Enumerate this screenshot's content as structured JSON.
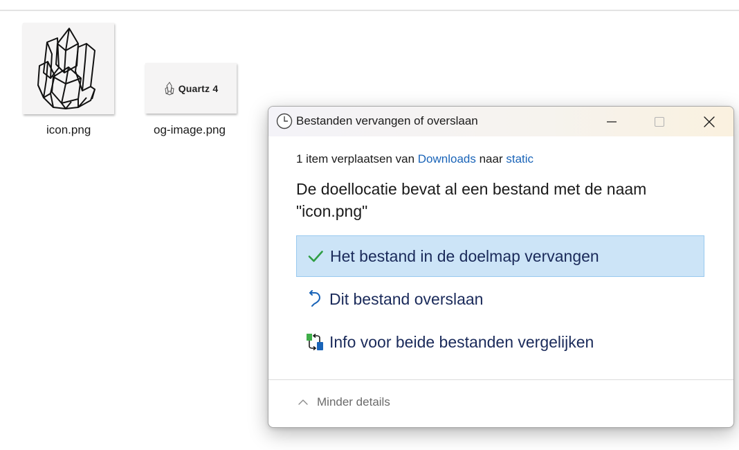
{
  "files": [
    {
      "name": "icon.png",
      "preview": "crystal-drawing"
    },
    {
      "name": "og-image.png",
      "preview_text": "Quartz 4"
    }
  ],
  "dialog": {
    "title": "Bestanden vervangen of overslaan",
    "subtitle": {
      "prefix": "1 item verplaatsen van ",
      "source": "Downloads",
      "middle": " naar ",
      "target": "static"
    },
    "heading": "De doellocatie bevat al een bestand met de naam \"icon.png\"",
    "options": [
      {
        "label": "Het bestand in de doelmap vervangen",
        "icon": "checkmark-icon",
        "selected": true
      },
      {
        "label": "Dit bestand overslaan",
        "icon": "skip-arrow-icon",
        "selected": false
      },
      {
        "label": "Info voor beide bestanden vergelijken",
        "icon": "compare-icon",
        "selected": false
      }
    ],
    "details_toggle": "Minder details"
  },
  "colors": {
    "link": "#1a64b8",
    "selected_bg": "#cce4f7",
    "selected_border": "#99c9ef",
    "check_green": "#2f9e44",
    "option_text": "#1a2a5a"
  }
}
